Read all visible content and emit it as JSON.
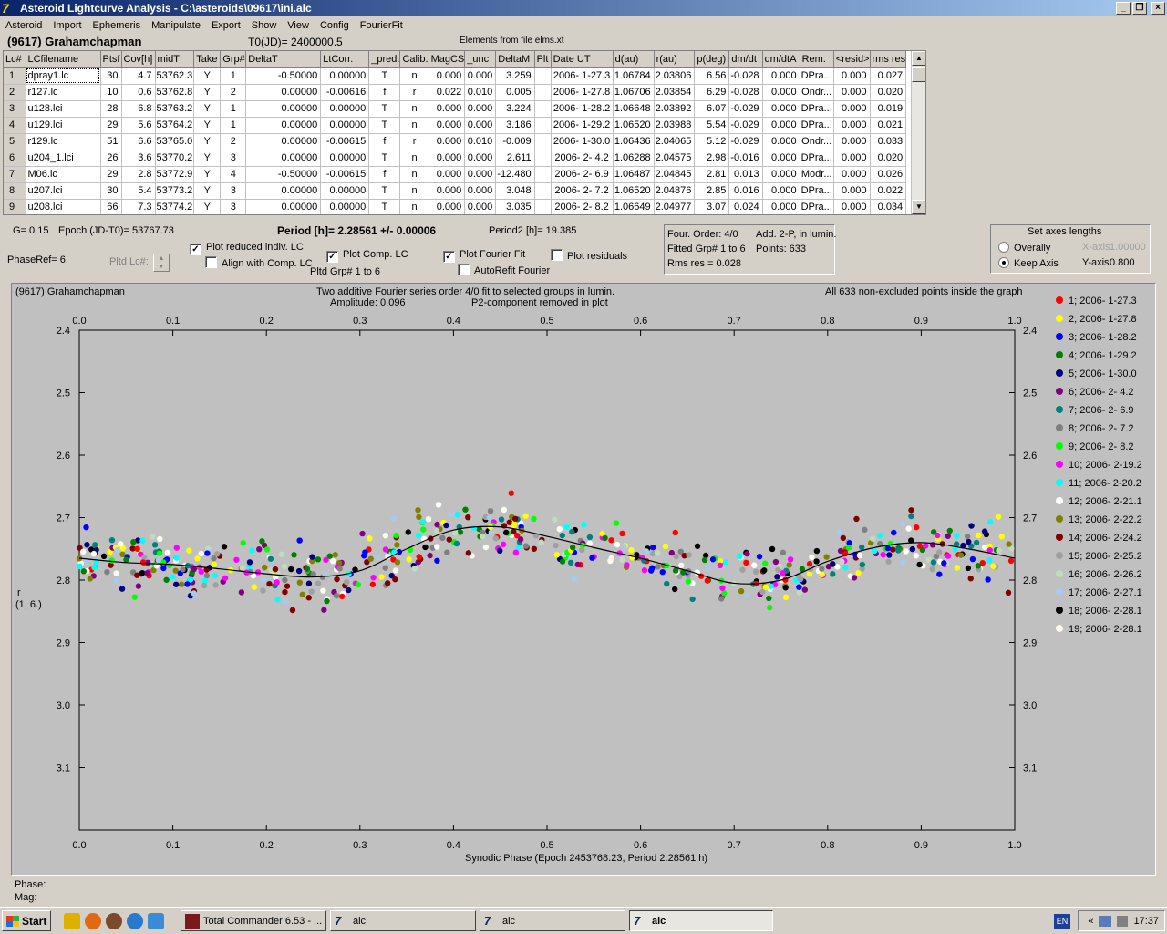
{
  "window": {
    "title": "Asteroid Lightcurve Analysis - C:\\asteroids\\09617\\ini.alc",
    "minimize": "_",
    "restore": "❐",
    "close": "×"
  },
  "menu": [
    "Asteroid",
    "Import",
    "Ephemeris",
    "Manipulate",
    "Export",
    "Show",
    "View",
    "Config",
    "FourierFit"
  ],
  "header": {
    "asteroid": "(9617) Grahamchapman",
    "t0": "T0(JD)= 2400000.5",
    "elements": "Elements from file elms.xt"
  },
  "table": {
    "columns": [
      "Lc#",
      "LCfilename",
      "Ptsf",
      "Cov[h]",
      "midT",
      "Take",
      "Grp#",
      "DeltaT",
      "LtCorr.",
      "_pred.",
      "Calib.",
      "MagCS",
      "_unc",
      "DeltaM",
      "Plt",
      "Date UT",
      "d(au)",
      "r(au)",
      "p(deg)",
      "dm/dt",
      "dm/dtA",
      "Rem.",
      "<resid>",
      "rms res"
    ],
    "rows": [
      [
        "1",
        "dpray1.lc",
        "30",
        "4.7",
        "53762.3",
        "Y",
        "1",
        "-0.50000",
        "0.00000",
        "T",
        "n",
        "0.000",
        "0.000",
        "3.259",
        "",
        "2006- 1-27.3",
        "1.06784",
        "2.03806",
        "6.56",
        "-0.028",
        "0.000",
        "DPra...",
        "0.000",
        "0.027"
      ],
      [
        "2",
        "r127.lc",
        "10",
        "0.6",
        "53762.8",
        "Y",
        "2",
        "0.00000",
        "-0.00616",
        "f",
        "r",
        "0.022",
        "0.010",
        "0.005",
        "",
        "2006- 1-27.8",
        "1.06706",
        "2.03854",
        "6.29",
        "-0.028",
        "0.000",
        "Ondr...",
        "0.000",
        "0.020"
      ],
      [
        "3",
        "u128.lci",
        "28",
        "6.8",
        "53763.2",
        "Y",
        "1",
        "0.00000",
        "0.00000",
        "T",
        "n",
        "0.000",
        "0.000",
        "3.224",
        "",
        "2006- 1-28.2",
        "1.06648",
        "2.03892",
        "6.07",
        "-0.029",
        "0.000",
        "DPra...",
        "0.000",
        "0.019"
      ],
      [
        "4",
        "u129.lci",
        "29",
        "5.6",
        "53764.2",
        "Y",
        "1",
        "0.00000",
        "0.00000",
        "T",
        "n",
        "0.000",
        "0.000",
        "3.186",
        "",
        "2006- 1-29.2",
        "1.06520",
        "2.03988",
        "5.54",
        "-0.029",
        "0.000",
        "DPra...",
        "0.000",
        "0.021"
      ],
      [
        "5",
        "r129.lc",
        "51",
        "6.6",
        "53765.0",
        "Y",
        "2",
        "0.00000",
        "-0.00615",
        "f",
        "r",
        "0.000",
        "0.010",
        "-0.009",
        "",
        "2006- 1-30.0",
        "1.06436",
        "2.04065",
        "5.12",
        "-0.029",
        "0.000",
        "Ondr...",
        "0.000",
        "0.033"
      ],
      [
        "6",
        "u204_1.lci",
        "26",
        "3.6",
        "53770.2",
        "Y",
        "3",
        "0.00000",
        "0.00000",
        "T",
        "n",
        "0.000",
        "0.000",
        "2.611",
        "",
        "2006- 2- 4.2",
        "1.06288",
        "2.04575",
        "2.98",
        "-0.016",
        "0.000",
        "DPra...",
        "0.000",
        "0.020"
      ],
      [
        "7",
        "M06.lc",
        "29",
        "2.8",
        "53772.9",
        "Y",
        "4",
        "-0.50000",
        "-0.00615",
        "f",
        "n",
        "0.000",
        "0.000",
        "-12.480",
        "",
        "2006- 2- 6.9",
        "1.06487",
        "2.04845",
        "2.81",
        "0.013",
        "0.000",
        "Modr...",
        "0.000",
        "0.026"
      ],
      [
        "8",
        "u207.lci",
        "30",
        "5.4",
        "53773.2",
        "Y",
        "3",
        "0.00000",
        "0.00000",
        "T",
        "n",
        "0.000",
        "0.000",
        "3.048",
        "",
        "2006- 2- 7.2",
        "1.06520",
        "2.04876",
        "2.85",
        "0.016",
        "0.000",
        "DPra...",
        "0.000",
        "0.022"
      ],
      [
        "9",
        "u208.lci",
        "66",
        "7.3",
        "53774.2",
        "Y",
        "3",
        "0.00000",
        "0.00000",
        "T",
        "n",
        "0.000",
        "0.000",
        "3.035",
        "",
        "2006- 2- 8.2",
        "1.06649",
        "2.04977",
        "3.07",
        "0.024",
        "0.000",
        "DPra...",
        "0.000",
        "0.034"
      ]
    ]
  },
  "controls": {
    "g": "G= 0.15",
    "epoch": "Epoch (JD-T0)= 53767.73",
    "period": "Period [h]= 2.28561 +/- 0.00006",
    "period2": "Period2 [h]= 19.385",
    "phaseref": "PhaseRef= 6.",
    "pltd_lc": "Pltd Lc#:",
    "plot_reduced": "Plot reduced indiv. LC",
    "align_comp": "Align with Comp. LC",
    "plot_comp": "Plot Comp. LC",
    "pltd_grp": "Pltd Grp#  1   to   6",
    "plot_fourier": "Plot Fourier Fit",
    "autorefit": "AutoRefit Fourier",
    "plot_residuals": "Plot residuals",
    "check_mark": "✓"
  },
  "fourier_panel": {
    "order": "Four. Order:  4/0",
    "add": "Add. 2-P, in lumin.",
    "fitted": "Fitted Grp# 1 to 6",
    "points": "Points: 633",
    "rms": "Rms res       = 0.028"
  },
  "axes_panel": {
    "title": "Set axes lengths",
    "overally": "Overally",
    "keep_axis": "Keep Axis",
    "xaxis_label": "X-axis:",
    "xaxis_value": "1.00000",
    "yaxis_label": "Y-axis:",
    "yaxis_value": "0.800"
  },
  "chart_data": {
    "type": "scatter",
    "title_left": "(9617) Grahamchapman",
    "title_center_1": "Two additive Fourier series order 4/0 fit to selected groups in lumin.",
    "title_center_2": "Amplitude: 0.096",
    "title_center_3": "P2-component removed in plot",
    "title_right": "All 633 non-excluded points inside the graph",
    "xlabel": "Synodic Phase (Epoch 2453768.23, Period 2.28561 h)",
    "ylabel_1": "r",
    "ylabel_2": "(1, 6.)",
    "xlim": [
      0.0,
      1.0
    ],
    "ylim": [
      2.4,
      3.2
    ],
    "y_inverted": true,
    "x_ticks": [
      "0.0",
      "0.1",
      "0.2",
      "0.3",
      "0.4",
      "0.5",
      "0.6",
      "0.7",
      "0.8",
      "0.9",
      "1.0"
    ],
    "y_ticks": [
      "2.4",
      "2.5",
      "2.6",
      "2.7",
      "2.8",
      "2.9",
      "3.0",
      "3.1"
    ],
    "fit_curve": {
      "x": [
        0.0,
        0.05,
        0.1,
        0.15,
        0.2,
        0.25,
        0.3,
        0.35,
        0.4,
        0.45,
        0.5,
        0.55,
        0.6,
        0.65,
        0.7,
        0.75,
        0.8,
        0.85,
        0.9,
        0.95,
        1.0
      ],
      "y": [
        2.765,
        2.772,
        2.775,
        2.782,
        2.79,
        2.795,
        2.785,
        2.75,
        2.72,
        2.715,
        2.73,
        2.748,
        2.765,
        2.785,
        2.805,
        2.8,
        2.77,
        2.748,
        2.74,
        2.75,
        2.765
      ]
    },
    "legend": [
      {
        "name": "1; 2006- 1-27.3",
        "color": "#ff0000"
      },
      {
        "name": "2; 2006- 1-27.8",
        "color": "#ffff00"
      },
      {
        "name": "3; 2006- 1-28.2",
        "color": "#0000ff"
      },
      {
        "name": "4; 2006- 1-29.2",
        "color": "#008000"
      },
      {
        "name": "5; 2006- 1-30.0",
        "color": "#000080"
      },
      {
        "name": "6; 2006- 2- 4.2",
        "color": "#800080"
      },
      {
        "name": "7; 2006- 2- 6.9",
        "color": "#008080"
      },
      {
        "name": "8; 2006- 2- 7.2",
        "color": "#808080"
      },
      {
        "name": "9; 2006- 2- 8.2",
        "color": "#00ff00"
      },
      {
        "name": "10; 2006- 2-19.2",
        "color": "#ff00ff"
      },
      {
        "name": "11; 2006- 2-20.2",
        "color": "#00ffff"
      },
      {
        "name": "12; 2006- 2-21.1",
        "color": "#ffffff"
      },
      {
        "name": "13; 2006- 2-22.2",
        "color": "#808000"
      },
      {
        "name": "14; 2006- 2-24.2",
        "color": "#800000"
      },
      {
        "name": "15; 2006- 2-25.2",
        "color": "#a0a0a0"
      },
      {
        "name": "16; 2006- 2-26.2",
        "color": "#c0dcc0"
      },
      {
        "name": "17; 2006- 2-27.1",
        "color": "#a6caf0"
      },
      {
        "name": "18; 2006- 2-28.1",
        "color": "#000000"
      },
      {
        "name": "19; 2006- 2-28.1",
        "color": "#fffbf0"
      }
    ]
  },
  "status": {
    "phase": "Phase:",
    "mag": "Mag:"
  },
  "taskbar": {
    "start": "Start",
    "tasks": [
      "Total Commander 6.53 - ...",
      "alc",
      "alc",
      "alc"
    ],
    "lang": "EN",
    "tray_arrows": "«",
    "clock": "17:37"
  }
}
